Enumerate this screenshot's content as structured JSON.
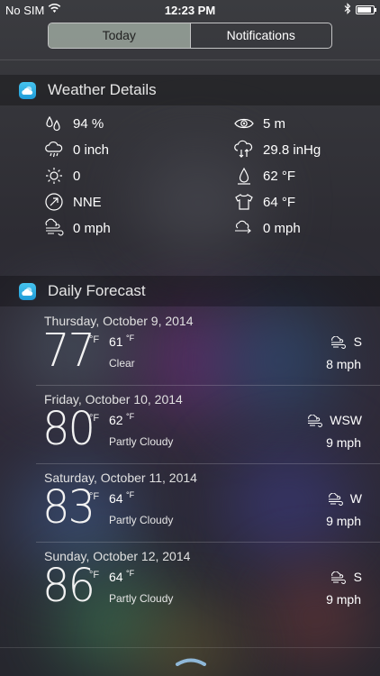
{
  "status_bar": {
    "carrier": "No SIM",
    "time": "12:23 PM",
    "wifi_icon": "wifi-icon",
    "bluetooth_icon": "bluetooth-icon",
    "battery_icon": "battery-icon"
  },
  "segmented_control": {
    "tabs": [
      "Today",
      "Notifications"
    ],
    "selected": "Today"
  },
  "weather_details": {
    "title": "Weather Details",
    "items": [
      {
        "icon": "humidity-icon",
        "value": "94 %"
      },
      {
        "icon": "visibility-icon",
        "value": "5 m"
      },
      {
        "icon": "precipitation-icon",
        "value": "0 inch"
      },
      {
        "icon": "pressure-icon",
        "value": "29.8 inHg"
      },
      {
        "icon": "uv-sun-icon",
        "value": "0"
      },
      {
        "icon": "dew-point-icon",
        "value": "62 °F"
      },
      {
        "icon": "wind-direction-icon",
        "value": "NNE"
      },
      {
        "icon": "feels-like-shirt-icon",
        "value": "64 °F"
      },
      {
        "icon": "wind-icon",
        "value": "0 mph"
      },
      {
        "icon": "gust-icon",
        "value": "0 mph"
      }
    ]
  },
  "daily_forecast": {
    "title": "Daily Forecast",
    "days": [
      {
        "date": "Thursday, October 9, 2014",
        "high": "77",
        "high_unit": "°F",
        "low": "61",
        "low_unit": "°F",
        "condition": "Clear",
        "wind_dir": "S",
        "wind_speed": "8 mph"
      },
      {
        "date": "Friday, October 10, 2014",
        "high": "80",
        "high_unit": "°F",
        "low": "62",
        "low_unit": "°F",
        "condition": "Partly Cloudy",
        "wind_dir": "WSW",
        "wind_speed": "9 mph"
      },
      {
        "date": "Saturday, October 11, 2014",
        "high": "83",
        "high_unit": "°F",
        "low": "64",
        "low_unit": "°F",
        "condition": "Partly Cloudy",
        "wind_dir": "W",
        "wind_speed": "9 mph"
      },
      {
        "date": "Sunday, October 12, 2014",
        "high": "86",
        "high_unit": "°F",
        "low": "64",
        "low_unit": "°F",
        "condition": "Partly Cloudy",
        "wind_dir": "S",
        "wind_speed": "9 mph"
      }
    ]
  },
  "bottom": {
    "grabber_icon": "chevron-up-grabber-icon"
  },
  "colors": {
    "accent": "#2ea7e0",
    "background": "#2d2c33"
  }
}
